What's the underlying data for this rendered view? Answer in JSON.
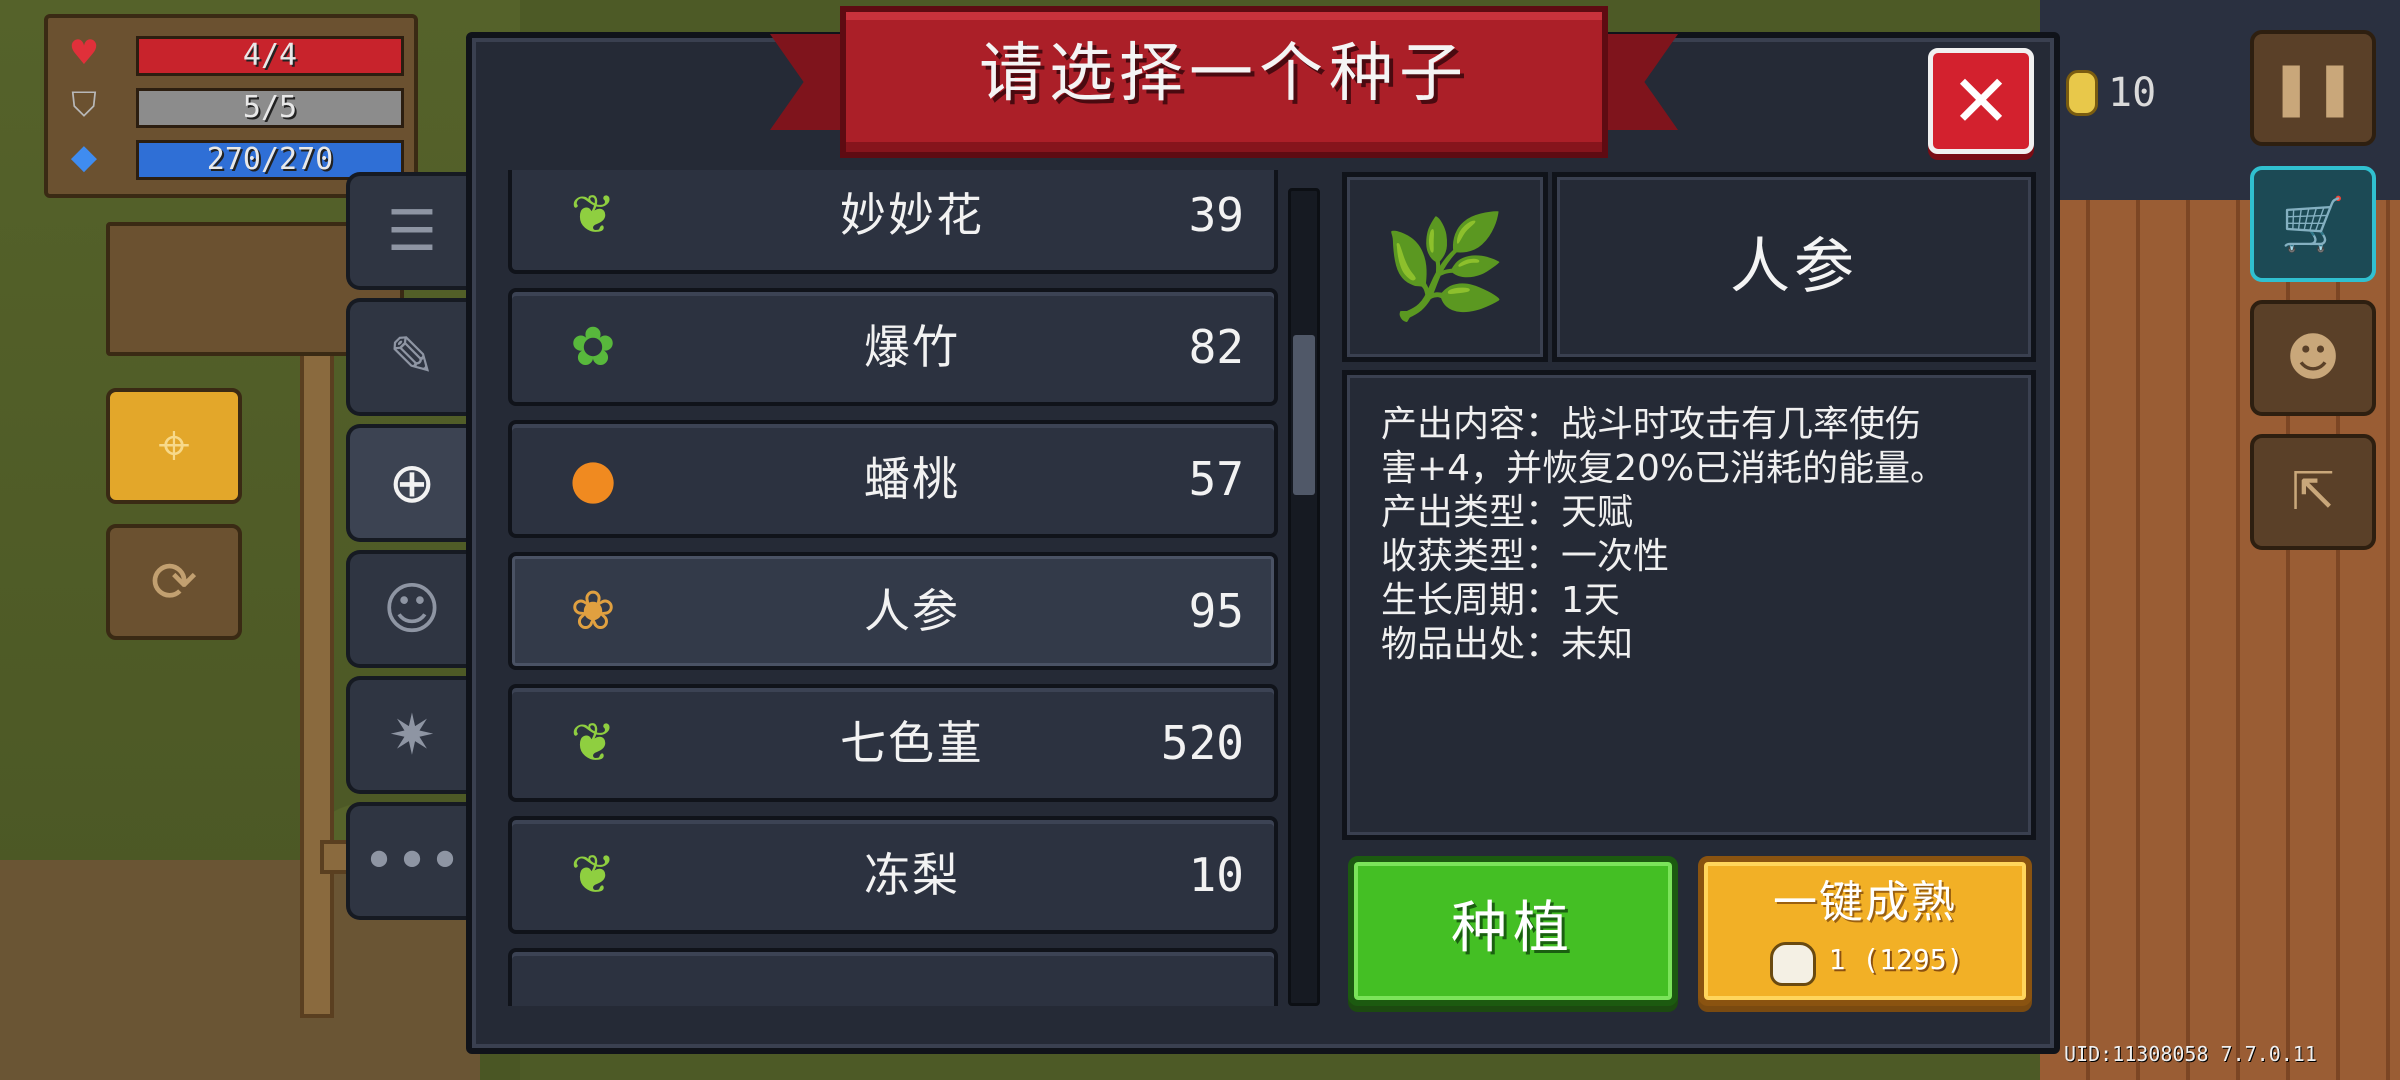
{
  "hud": {
    "health": "4/4",
    "health_fraction": 1.0,
    "armor": "5/5",
    "armor_fraction": 1.0,
    "energy": "270/270",
    "energy_fraction": 1.0,
    "coins": "10",
    "uid": "UID:11308058 7.7.0.11"
  },
  "dialog": {
    "title": "请选择一个种子",
    "close_icon": "close-x-icon",
    "tabs": [
      {
        "icon": "list-icon"
      },
      {
        "icon": "weapon-icon"
      },
      {
        "icon": "seed-icon"
      },
      {
        "icon": "pet-icon"
      },
      {
        "icon": "burst-icon"
      },
      {
        "icon": "more-icon"
      }
    ],
    "seeds": [
      {
        "name": "妙妙花",
        "price": "39",
        "icon": "sprout-seed-icon"
      },
      {
        "name": "爆竹",
        "price": "82",
        "icon": "bamboo-seed-icon"
      },
      {
        "name": "蟠桃",
        "price": "57",
        "icon": "peach-seed-icon"
      },
      {
        "name": "人参",
        "price": "95",
        "icon": "ginseng-seed-icon",
        "selected": true
      },
      {
        "name": "七色堇",
        "price": "520",
        "icon": "rainbow-seed-icon"
      },
      {
        "name": "冻梨",
        "price": "10",
        "icon": "pear-seed-icon"
      }
    ],
    "scroll_position": 0.22,
    "detail": {
      "name": "人参",
      "icon": "ginseng-plant-icon",
      "lines": [
        "产出内容：战斗时攻击有几率使伤",
        "害+4，并恢复20%已消耗的能量。",
        "产出类型：天赋",
        "收获类型：一次性",
        "生长周期：1天",
        "物品出处：未知"
      ]
    },
    "plant_button": "种植",
    "ripen_button": "一键成熟",
    "ripen_cost": "1 (1295)"
  },
  "colors": {
    "health": "#c8232c",
    "armor": "#8c8c8c",
    "energy": "#2f6fd6",
    "panel": "#252a36",
    "banner": "#ab1f28",
    "plant": "#44bf24",
    "ripen": "#f2b026"
  }
}
